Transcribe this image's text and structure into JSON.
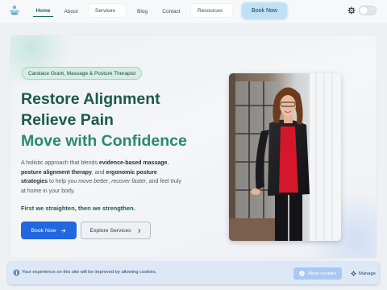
{
  "nav": {
    "home": "Home",
    "about": "About",
    "services": "Services",
    "blog": "Blog",
    "contact": "Contact",
    "resources": "Resources",
    "book_now": "Book Now",
    "active_item": "Home",
    "theme_toggle_on": false
  },
  "hero": {
    "badge": "Candace Grant, Massage & Posture Therapist",
    "headline": [
      "Restore Alignment",
      "Relieve Pain",
      "Move with Confidence"
    ],
    "description": {
      "p1": "A holistic approach that blends ",
      "b1": "evidence-based massage",
      "p2": ", ",
      "b2": "posture alignment therapy",
      "p3": ", and ",
      "b3": "ergonomic posture strategies",
      "p4": " to help you ",
      "i1": "move better",
      "p5": ", ",
      "i2": "recover faster",
      "p6": ", and feel truly at home in your body."
    },
    "tagline": "First we straighten, then we strengthen.",
    "primary_button": "Book Now",
    "secondary_button": "Explore Services"
  },
  "cookie": {
    "message": "Your experience on this site will be improved by allowing cookies.",
    "allow": "Allow cookies",
    "manage": "Manage"
  },
  "colors": {
    "brand_green": "#1c5a48",
    "accent_green": "#2a8a6c",
    "primary_blue": "#2266e0",
    "book_top_bg": "#bfe1f8",
    "cookie_bg": "#dde8f7"
  },
  "icons": [
    "logo-icon",
    "chevron-down-icon",
    "gear-icon",
    "arrow-right-icon",
    "chevron-right-icon",
    "info-icon",
    "check-icon"
  ]
}
